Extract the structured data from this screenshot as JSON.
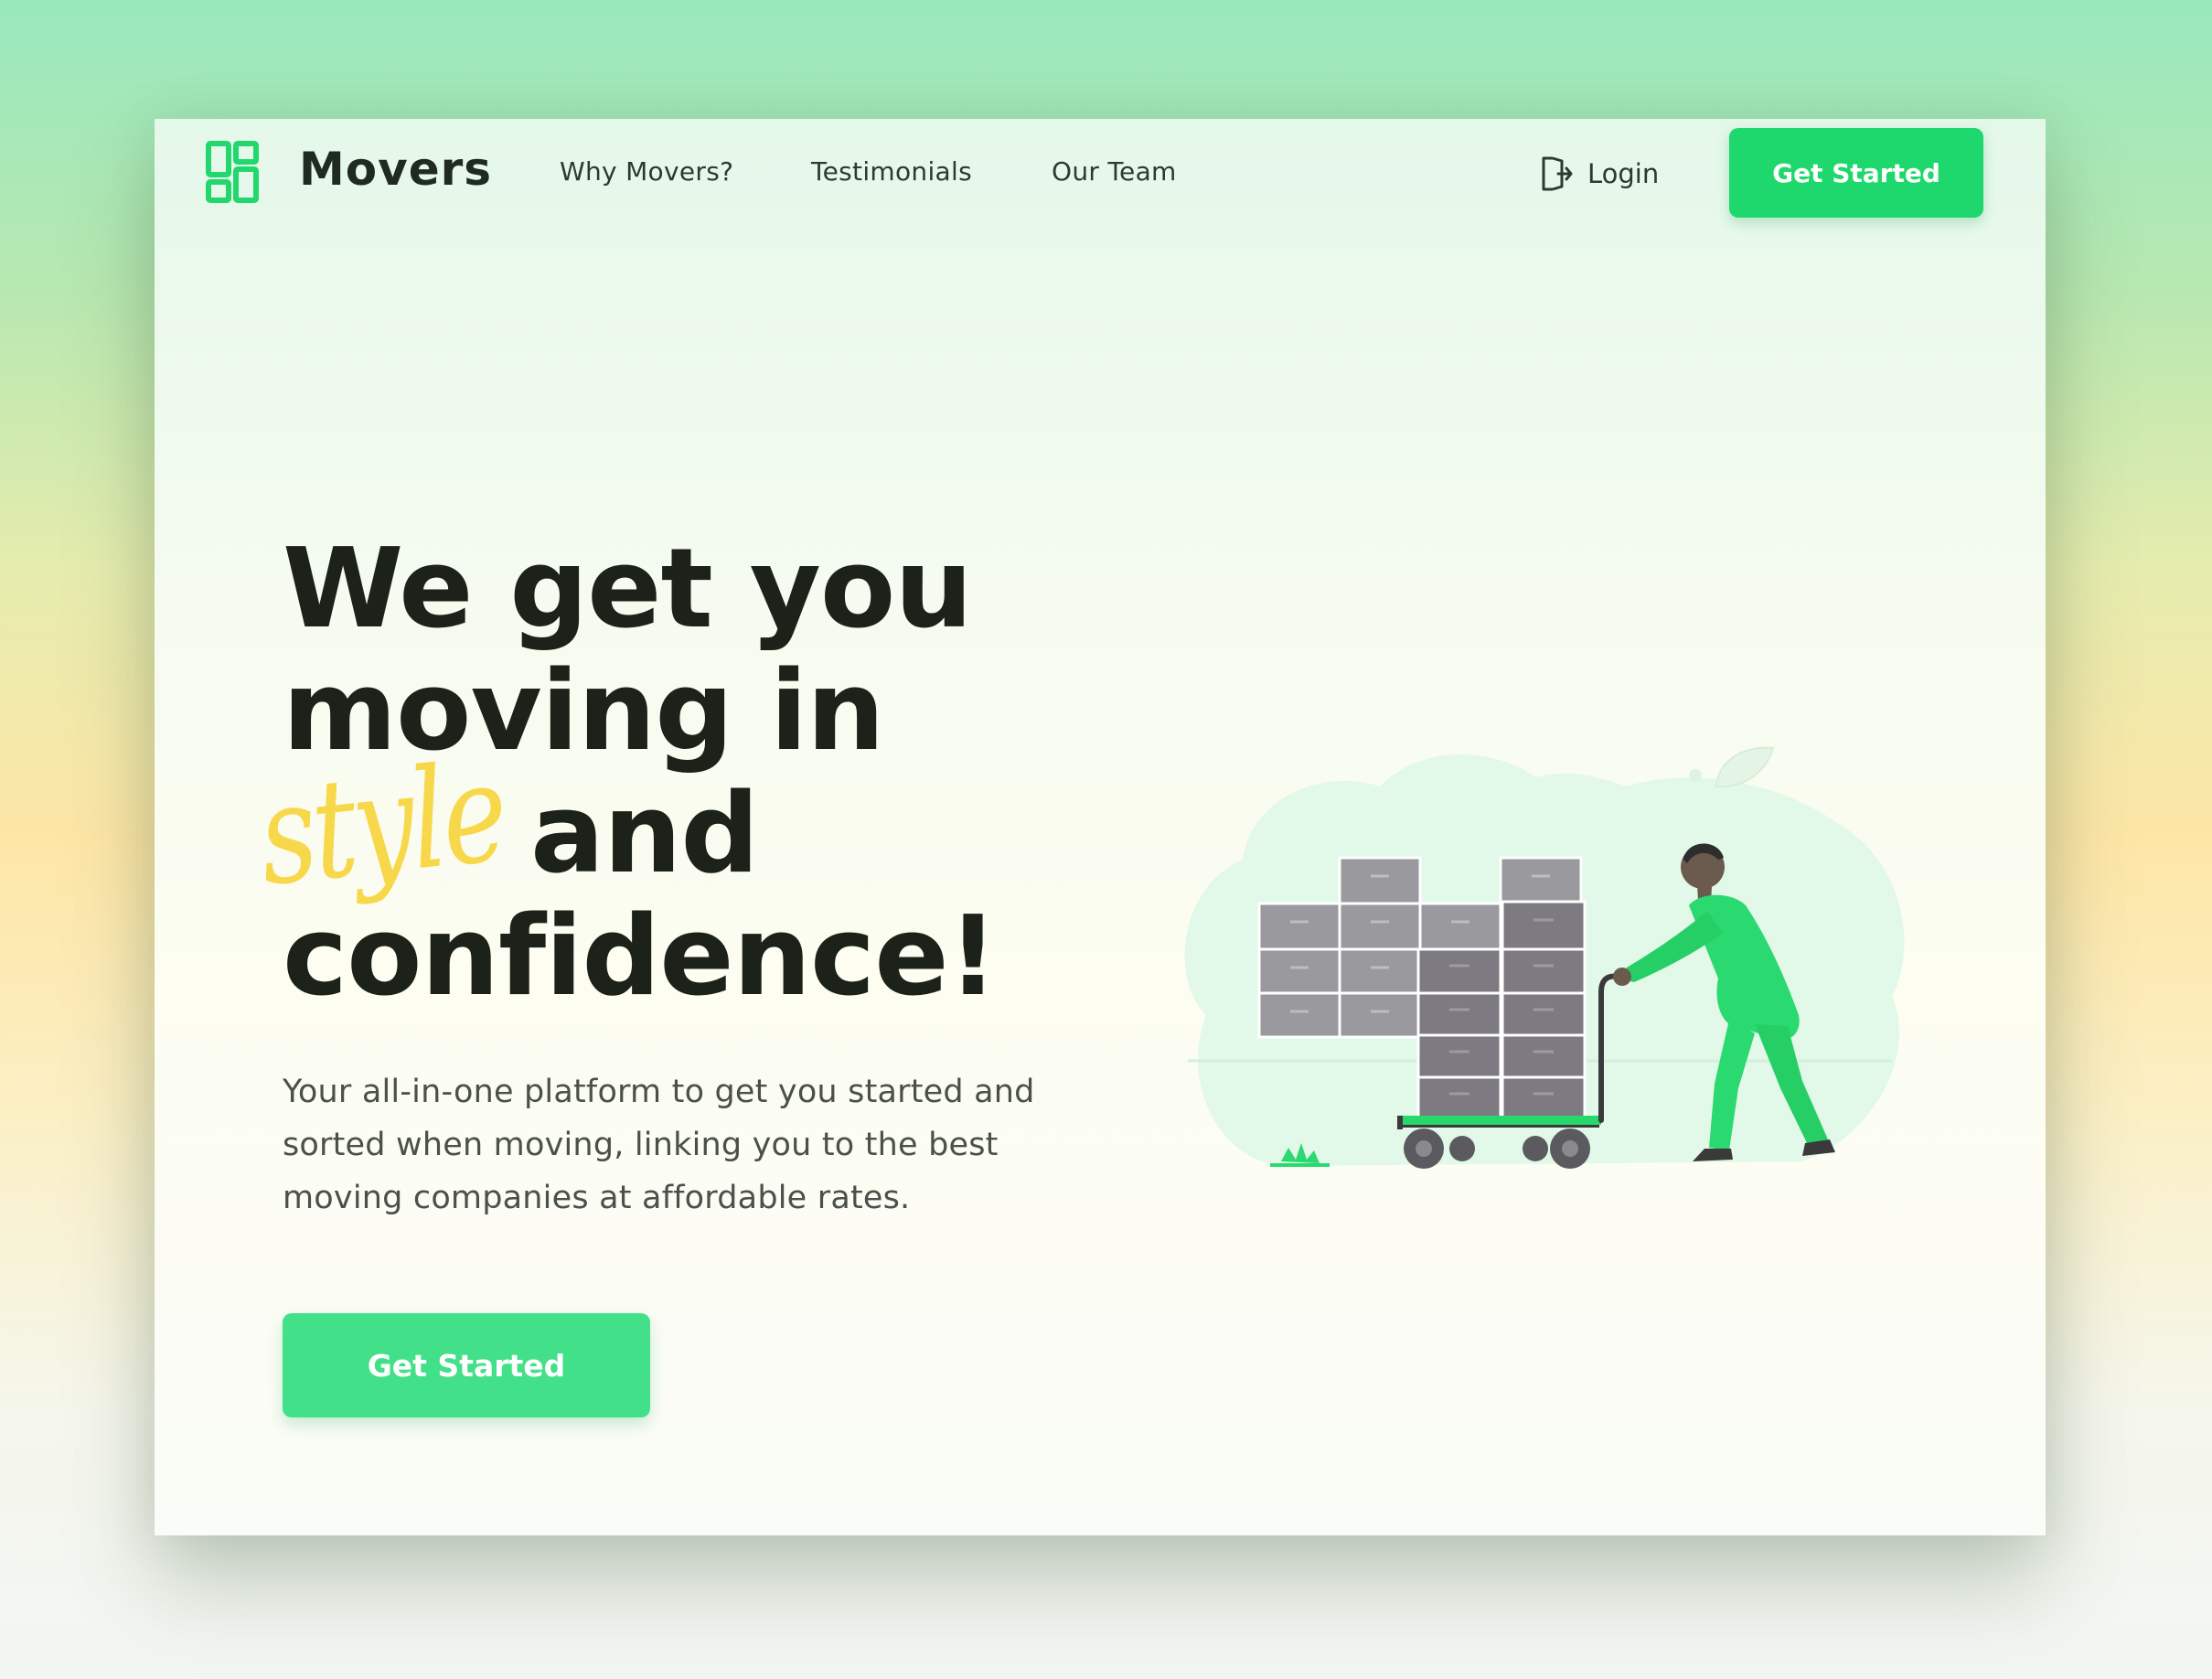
{
  "brand": {
    "name": "Movers",
    "logo_icon": "grid-layout-icon",
    "accent_color": "#1fd86d"
  },
  "nav": {
    "links": [
      "Why Movers?",
      "Testimonials",
      "Our Team"
    ],
    "login_label": "Login",
    "login_icon": "sign-in-icon",
    "cta_label": "Get Started"
  },
  "hero": {
    "headline_line1": "We get you",
    "headline_line2": "moving in",
    "headline_script": "style",
    "headline_line3_rest": "and",
    "headline_line4": "confidence!",
    "script_color": "#f7d84a",
    "subtext": "Your all-in-one platform to get you started and sorted when moving, linking you to the best moving companies at affordable rates.",
    "cta_label": "Get Started",
    "illustration": "mover-pushing-boxes-on-cart"
  }
}
